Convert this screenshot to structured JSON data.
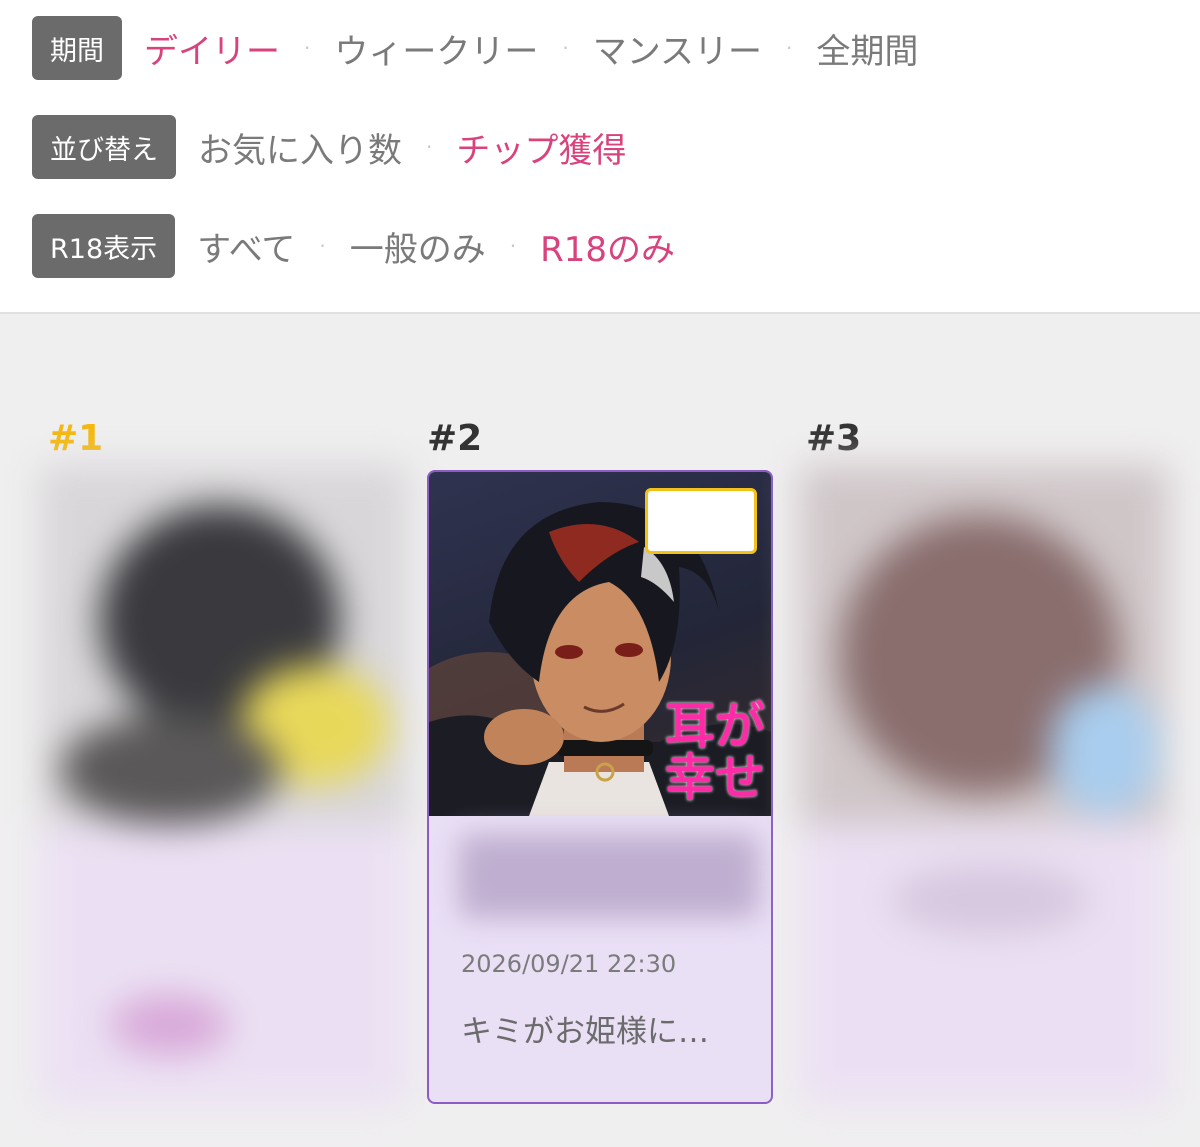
{
  "filters": {
    "period": {
      "label": "期間",
      "options": [
        "デイリー",
        "ウィークリー",
        "マンスリー",
        "全期間"
      ],
      "selected": "デイリー"
    },
    "sort": {
      "label": "並び替え",
      "options": [
        "お気に入り数",
        "チップ獲得"
      ],
      "selected": "チップ獲得"
    },
    "r18": {
      "label": "R18表示",
      "options": [
        "すべて",
        "一般のみ",
        "R18のみ"
      ],
      "selected": "R18のみ"
    },
    "separator": "·",
    "active_color": "#d9437d"
  },
  "ranking": [
    {
      "rank": "#1",
      "rank_color": "#f5b80f",
      "blurred": true
    },
    {
      "rank": "#2",
      "blurred": false,
      "thumbnail_text": "耳が幸せ",
      "date": "2026/09/21 22:30",
      "title": "キミがお姫様に…"
    },
    {
      "rank": "#3",
      "blurred": true
    }
  ]
}
